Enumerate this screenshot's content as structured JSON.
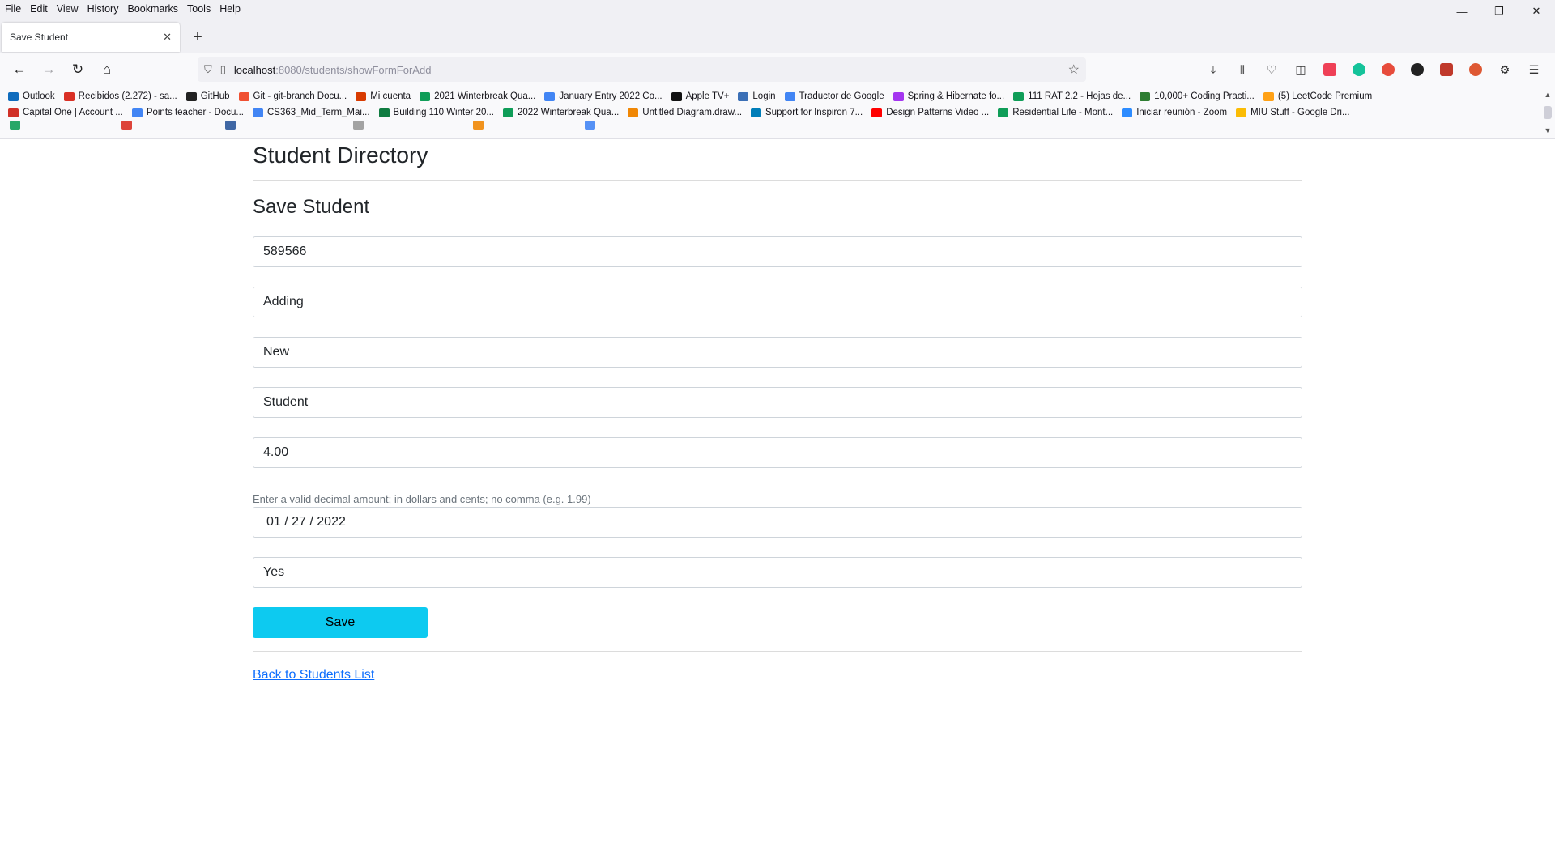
{
  "menu": [
    "File",
    "Edit",
    "View",
    "History",
    "Bookmarks",
    "Tools",
    "Help"
  ],
  "window_controls": {
    "minimize": "—",
    "restore": "❐",
    "close": "✕"
  },
  "tab": {
    "title": "Save Student",
    "close": "✕",
    "new": "+"
  },
  "nav": {
    "back": "←",
    "forward": "→",
    "reload": "↻",
    "home": "⌂"
  },
  "url": {
    "host": "localhost",
    "path": ":8080/students/showFormForAdd",
    "shield": "⛉",
    "lock": "▯",
    "star": "☆"
  },
  "toolbar_icons": [
    "⤓",
    "⫴",
    "♡",
    "◫"
  ],
  "extensions": [
    {
      "name": "pocket",
      "color": "#ef4056"
    },
    {
      "name": "grammarly",
      "color": "#15c39a"
    },
    {
      "name": "adblock",
      "color": "#e74c3c"
    },
    {
      "name": "dashlane",
      "color": "#222"
    },
    {
      "name": "ublock",
      "color": "#c0392b"
    },
    {
      "name": "duckduckgo",
      "color": "#de5833"
    },
    {
      "name": "settings",
      "color": "#666"
    }
  ],
  "bookmarks_row1": [
    {
      "label": "Outlook",
      "color": "#0f6cbd"
    },
    {
      "label": "Recibidos (2.272) - sa...",
      "color": "#d93025"
    },
    {
      "label": "GitHub",
      "color": "#222"
    },
    {
      "label": "Git - git-branch Docu...",
      "color": "#f05032"
    },
    {
      "label": "Mi cuenta",
      "color": "#d83b01"
    },
    {
      "label": "2021 Winterbreak Qua...",
      "color": "#0f9d58"
    },
    {
      "label": "January Entry 2022 Co...",
      "color": "#4285f4"
    },
    {
      "label": "Apple TV+",
      "color": "#111"
    },
    {
      "label": "Login",
      "color": "#3b6fb6"
    },
    {
      "label": "Traductor de Google",
      "color": "#4285f4"
    },
    {
      "label": "Spring & Hibernate fo...",
      "color": "#a435f0"
    },
    {
      "label": "111 RAT 2.2 - Hojas de...",
      "color": "#0f9d58"
    },
    {
      "label": "10,000+ Coding Practi...",
      "color": "#2e7d32"
    },
    {
      "label": "(5) LeetCode Premium",
      "color": "#ffa116"
    }
  ],
  "bookmarks_row2": [
    {
      "label": "Capital One | Account ...",
      "color": "#d03027"
    },
    {
      "label": "Points teacher - Docu...",
      "color": "#4285f4"
    },
    {
      "label": "CS363_Mid_Term_Mai...",
      "color": "#4285f4"
    },
    {
      "label": "Building 110 Winter 20...",
      "color": "#107c41"
    },
    {
      "label": "2022 Winterbreak Qua...",
      "color": "#0f9d58"
    },
    {
      "label": "Untitled Diagram.draw...",
      "color": "#f08705"
    },
    {
      "label": "Support for Inspiron 7...",
      "color": "#007db8"
    },
    {
      "label": "Design Patterns Video ...",
      "color": "#ff0000"
    },
    {
      "label": "Residential Life - Mont...",
      "color": "#0f9d58"
    },
    {
      "label": "Iniciar reunión - Zoom",
      "color": "#2d8cff"
    },
    {
      "label": "MIU Stuff - Google Dri...",
      "color": "#fbbc04"
    }
  ],
  "page": {
    "title": "Student Directory",
    "subtitle": "Save Student",
    "fields": {
      "student_number": "589566",
      "first_name": "Adding",
      "middle_name": "New",
      "last_name": "Student",
      "cgpa": "4.00",
      "cgpa_help": "Enter a valid decimal amount; in dollars and cents; no comma (e.g. 1.99)",
      "date_of_enrollment": "01 / 27 / 2022",
      "is_international": "Yes"
    },
    "save_label": "Save",
    "back_link": "Back to Students List"
  }
}
